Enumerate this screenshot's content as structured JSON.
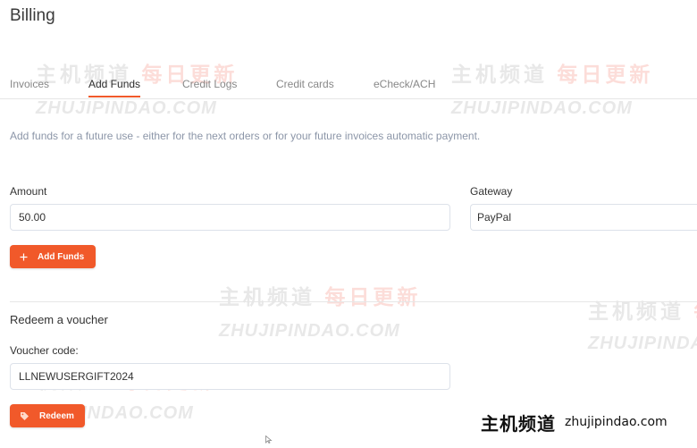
{
  "page": {
    "title": "Billing"
  },
  "tabs": [
    {
      "label": "Invoices",
      "active": false
    },
    {
      "label": "Add Funds",
      "active": true
    },
    {
      "label": "Credit Logs",
      "active": false
    },
    {
      "label": "Credit cards",
      "active": false
    },
    {
      "label": "eCheck/ACH",
      "active": false
    }
  ],
  "intro": "Add funds for a future use - either for the next orders or for your future invoices automatic payment.",
  "add_funds": {
    "amount_label": "Amount",
    "amount_value": "50.00",
    "gateway_label": "Gateway",
    "gateway_value": "PayPal",
    "button_label": "Add Funds"
  },
  "voucher": {
    "section_title": "Redeem a voucher",
    "code_label": "Voucher code:",
    "code_value": "LLNEWUSERGIFT2024",
    "button_label": "Redeem"
  },
  "watermark": {
    "cn_main": "主机频道",
    "cn_alt": "每日更新",
    "en": "ZHUJIPINDAO.COM"
  },
  "brand": {
    "cn": "主机频道",
    "en": "zhujipindao.com"
  },
  "colors": {
    "accent": "#f1592a",
    "muted_text": "#8c96a8",
    "border": "#dde2ea"
  },
  "icons": {
    "add": "plus-icon",
    "redeem": "tag-icon",
    "cursor": "mouse-cursor-icon"
  }
}
